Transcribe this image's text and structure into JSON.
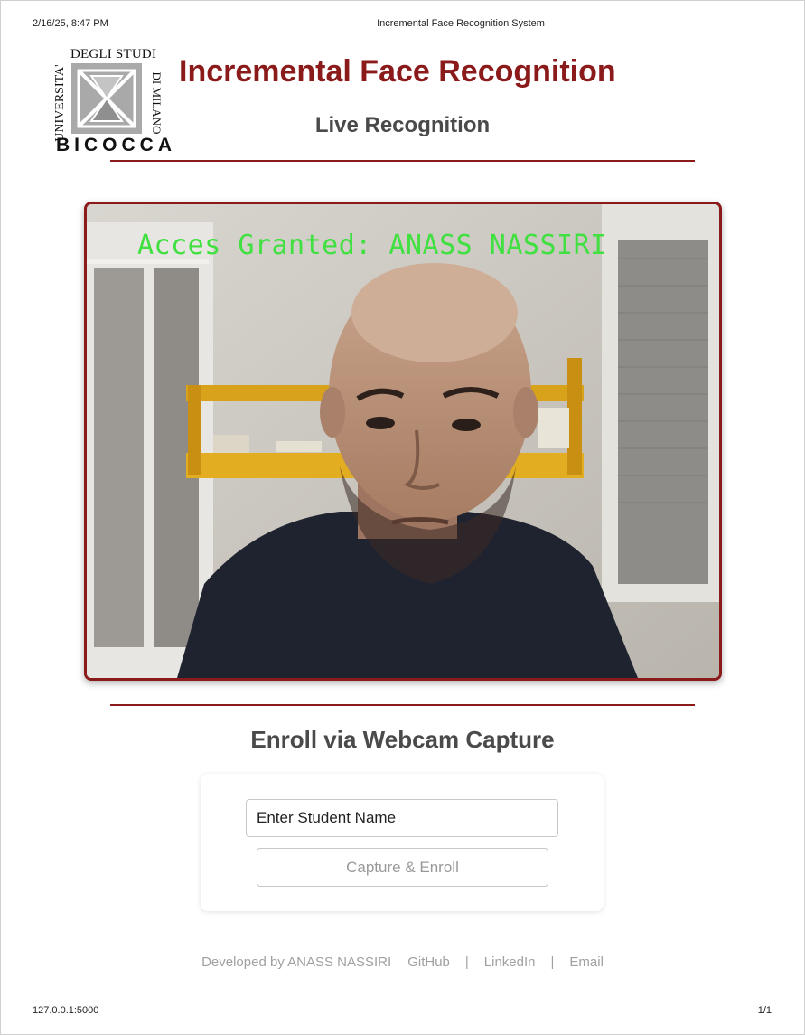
{
  "print": {
    "datetime": "2/16/25, 8:47 PM",
    "doc_title": "Incremental Face Recognition System",
    "url": "127.0.0.1:5000",
    "page_number": "1/1"
  },
  "logo": {
    "line_degli": "DEGLI STUDI",
    "line_universita": "UNIVERSITA'",
    "line_milano": "DI MILANO",
    "line_bicocca": "BICOCCA"
  },
  "header": {
    "title": "Incremental Face Recognition",
    "live_section": "Live Recognition"
  },
  "video": {
    "overlay_text": "Acces Granted: ANASS NASSIRI"
  },
  "enroll": {
    "section_title": "Enroll via Webcam Capture",
    "name_input_placeholder": "Enter Student Name",
    "capture_button_label": "Capture & Enroll"
  },
  "footer": {
    "developed_by": "Developed by ANASS NASSIRI",
    "links": [
      "GitHub",
      "LinkedIn",
      "Email"
    ],
    "separator": "|"
  },
  "colors": {
    "accent": "#8b1a1a",
    "overlay_green": "#3fe03f",
    "heading_gray": "#4a4a4a"
  }
}
